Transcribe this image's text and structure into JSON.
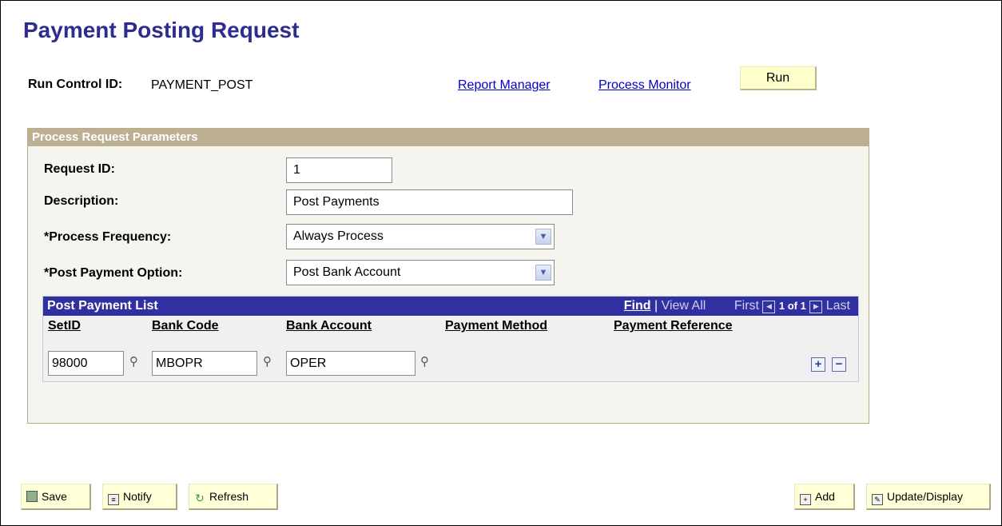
{
  "page": {
    "title": "Payment Posting Request"
  },
  "run_control": {
    "label": "Run Control ID:",
    "value": "PAYMENT_POST",
    "report_manager": "Report Manager",
    "process_monitor": "Process Monitor",
    "run_button": "Run"
  },
  "params": {
    "header": "Process Request Parameters",
    "request_id": {
      "label": "Request ID:",
      "value": "1"
    },
    "description": {
      "label": "Description:",
      "value": "Post Payments"
    },
    "process_frequency": {
      "label": "*Process Frequency:",
      "value": "Always Process"
    },
    "post_payment_option": {
      "label": "*Post Payment Option:",
      "value": "Post Bank Account"
    }
  },
  "grid": {
    "title": "Post Payment List",
    "find": "Find",
    "separator": "|",
    "view_all": "View All",
    "first": "First",
    "count": "1 of 1",
    "last": "Last",
    "columns": [
      "SetID",
      "Bank Code",
      "Bank Account",
      "Payment Method",
      "Payment Reference"
    ],
    "row": {
      "setid": "98000",
      "bank_code": "MBOPR",
      "bank_account": "OPER"
    }
  },
  "toolbar": {
    "save": "Save",
    "notify": "Notify",
    "refresh": "Refresh",
    "add": "Add",
    "update_display": "Update/Display"
  },
  "icons": {
    "select": "chevron-down-icon",
    "lookup": "search-icon",
    "add_row": "plus-icon",
    "delete_row": "minus-icon",
    "save": "save-icon",
    "notify": "notify-icon",
    "refresh": "refresh-icon",
    "add": "add-icon",
    "update": "update-icon"
  },
  "colors": {
    "title": "#2d2d8f",
    "link": "#0000cc",
    "group_header": "#bdb092",
    "grid_header": "#3030a0",
    "button_bg": "#ffffcc"
  }
}
